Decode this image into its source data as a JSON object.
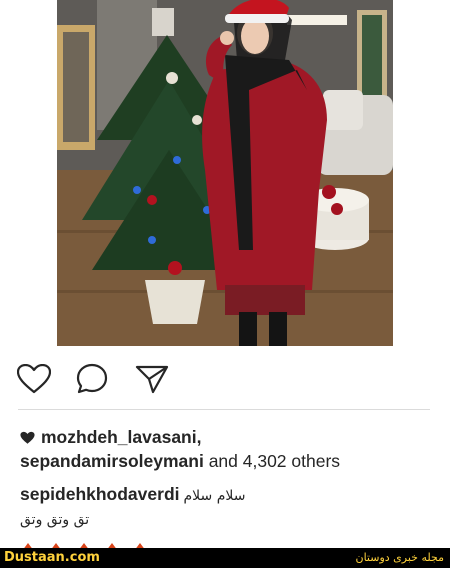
{
  "post": {
    "liked_by_user": "mozhdeh_lavasani,",
    "liked_by_second": "sepandamirsoleymani",
    "likes_rest": " and 4,302 others",
    "caption_user": "sepidehkhodaverdi",
    "caption_text": "سلام سلام",
    "caption_line2": "تق وتق وتق"
  },
  "footer": {
    "site": "Dustaan.com",
    "tagline": "مجله خبری دوستان"
  },
  "icons": {
    "like": "heart-outline-icon",
    "comment": "comment-bubble-icon",
    "share": "paper-plane-icon",
    "liked_marker": "heart-filled-icon"
  },
  "colors": {
    "text": "#262626",
    "divider": "#dbdbdb",
    "footer_bg": "#000000",
    "footer_text": "#ffd23c",
    "coat": "#a01826"
  }
}
